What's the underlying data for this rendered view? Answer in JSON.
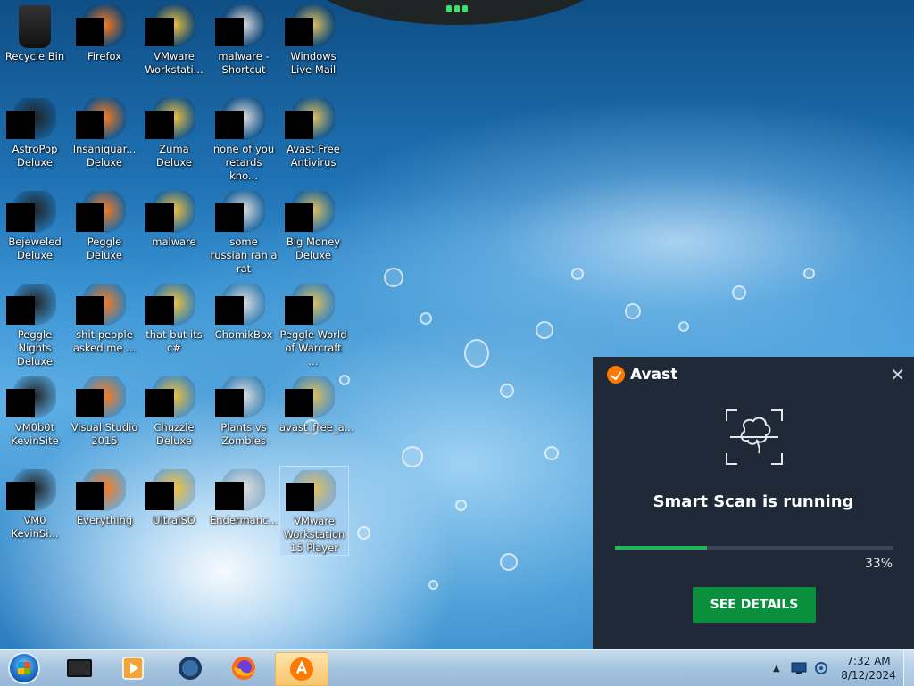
{
  "desktop_icons": [
    {
      "id": "recycle-bin",
      "label": "Recycle Bin"
    },
    {
      "id": "firefox",
      "label": "Firefox"
    },
    {
      "id": "vmware-workstation",
      "label": "VMware Workstati..."
    },
    {
      "id": "malware-shortcut",
      "label": "malware - Shortcut"
    },
    {
      "id": "windows-live-mail",
      "label": "Windows Live Mail"
    },
    {
      "id": "astropop-deluxe",
      "label": "AstroPop Deluxe"
    },
    {
      "id": "insaniquarium-deluxe",
      "label": "Insaniquar... Deluxe"
    },
    {
      "id": "zuma-deluxe",
      "label": "Zuma Deluxe"
    },
    {
      "id": "none-of-you",
      "label": "none of you retards kno..."
    },
    {
      "id": "avast-free-antivirus",
      "label": "Avast Free Antivirus"
    },
    {
      "id": "bejeweled-deluxe",
      "label": "Bejeweled Deluxe"
    },
    {
      "id": "peggle-deluxe",
      "label": "Peggle Deluxe"
    },
    {
      "id": "malware-folder",
      "label": "malware"
    },
    {
      "id": "some-russian",
      "label": "some russian ran a rat"
    },
    {
      "id": "big-money-deluxe",
      "label": "Big Money Deluxe"
    },
    {
      "id": "peggle-nights-deluxe",
      "label": "Peggle Nights Deluxe"
    },
    {
      "id": "shit-people",
      "label": "shit people asked me ..."
    },
    {
      "id": "that-but-its-c",
      "label": "that but its c#"
    },
    {
      "id": "chomikbox",
      "label": "ChomikBox"
    },
    {
      "id": "peggle-world-of-warcraft",
      "label": "Peggle World of Warcraft ..."
    },
    {
      "id": "vm0b0t-kevinsite",
      "label": "VM0b0t KevinSite"
    },
    {
      "id": "visual-studio-2015",
      "label": "Visual Studio 2015"
    },
    {
      "id": "chuzzle-deluxe",
      "label": "Chuzzle Deluxe"
    },
    {
      "id": "plants-vs-zombies",
      "label": "Plants vs Zombies"
    },
    {
      "id": "avast-free-a",
      "label": "avast_free_a..."
    },
    {
      "id": "vm0-kevinsi",
      "label": "VM0 KevinSi..."
    },
    {
      "id": "everything",
      "label": "Everything"
    },
    {
      "id": "ultraiso",
      "label": "UltraISO"
    },
    {
      "id": "endermanch",
      "label": "Endermanc..."
    },
    {
      "id": "vmware-workstation-15-player",
      "label": "VMware Workstation 15 Player"
    }
  ],
  "avast_popup": {
    "brand": "Avast",
    "title": "Smart Scan is running",
    "progress_percent": 33,
    "progress_label": "33%",
    "button_label": "SEE DETAILS",
    "accent_color": "#1fb75a",
    "button_color": "#0a8f3c",
    "brand_color": "#ff7800"
  },
  "taskbar": {
    "pinned": [
      {
        "icon": "start-orb-icon",
        "name": "start-button"
      },
      {
        "icon": "terminal-icon",
        "name": "taskbar-app-1"
      },
      {
        "icon": "media-player-icon",
        "name": "taskbar-app-2"
      },
      {
        "icon": "globe-icon",
        "name": "taskbar-app-3"
      },
      {
        "icon": "firefox-icon",
        "name": "taskbar-firefox"
      },
      {
        "icon": "avast-icon",
        "name": "taskbar-avast"
      }
    ],
    "clock": {
      "time": "7:32 AM",
      "date": "8/12/2024"
    }
  }
}
